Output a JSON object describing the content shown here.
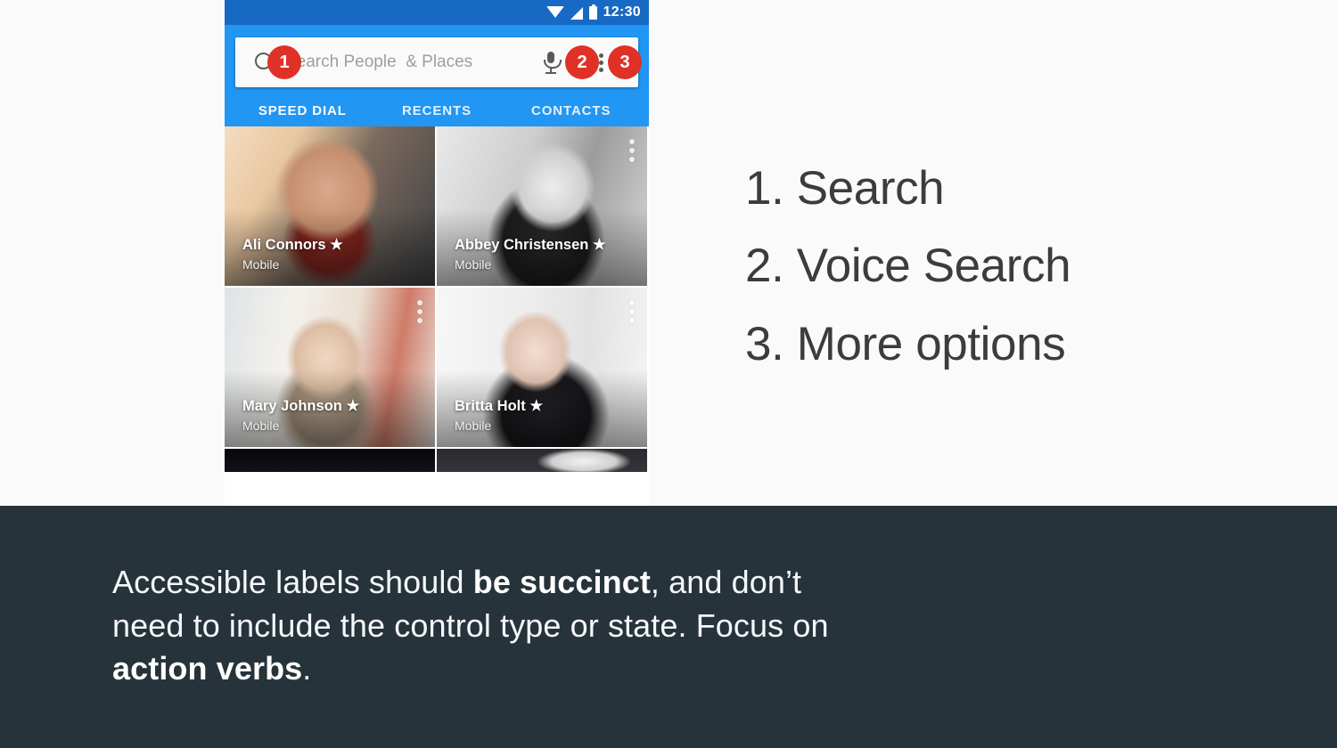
{
  "page": {
    "background_color": "#fafafa",
    "caption_band_color": "#27333b"
  },
  "phone": {
    "status_bar": {
      "time": "12:30",
      "icons": [
        "wifi-icon",
        "signal-icon",
        "battery-icon"
      ],
      "background_color": "#1769c4"
    },
    "app_bar": {
      "background_color": "#2196f3",
      "search": {
        "placeholder": "Search People  & Places",
        "search_icon": "search-icon",
        "mic_icon": "microphone-icon",
        "overflow_icon": "more-vert-icon"
      },
      "badges": [
        {
          "number": "1",
          "target": "search-icon",
          "color": "#e03127"
        },
        {
          "number": "2",
          "target": "microphone-icon",
          "color": "#e03127"
        },
        {
          "number": "3",
          "target": "more-vert-icon",
          "color": "#e03127"
        }
      ]
    },
    "tabs": [
      {
        "label": "SPEED DIAL",
        "active": true
      },
      {
        "label": "RECENTS",
        "active": false
      },
      {
        "label": "CONTACTS",
        "active": false
      }
    ],
    "contacts": [
      {
        "name": "Ali Connors",
        "star": "★",
        "subtitle": "Mobile",
        "has_overflow": false
      },
      {
        "name": "Abbey Christensen",
        "star": "★",
        "subtitle": "Mobile",
        "has_overflow": true
      },
      {
        "name": "Mary Johnson",
        "star": "★",
        "subtitle": "Mobile",
        "has_overflow": true
      },
      {
        "name": "Britta Holt",
        "star": "★",
        "subtitle": "Mobile",
        "has_overflow": true
      }
    ]
  },
  "legend": {
    "items": [
      "1. Search",
      "2. Voice Search",
      "3. More options"
    ],
    "text_color": "#3c3c3c"
  },
  "caption": {
    "part1": "Accessible labels should ",
    "bold1": "be succinct",
    "part2": ", and don’t need to include the control type or state. Focus on ",
    "bold2": "action verbs",
    "part3": "."
  }
}
